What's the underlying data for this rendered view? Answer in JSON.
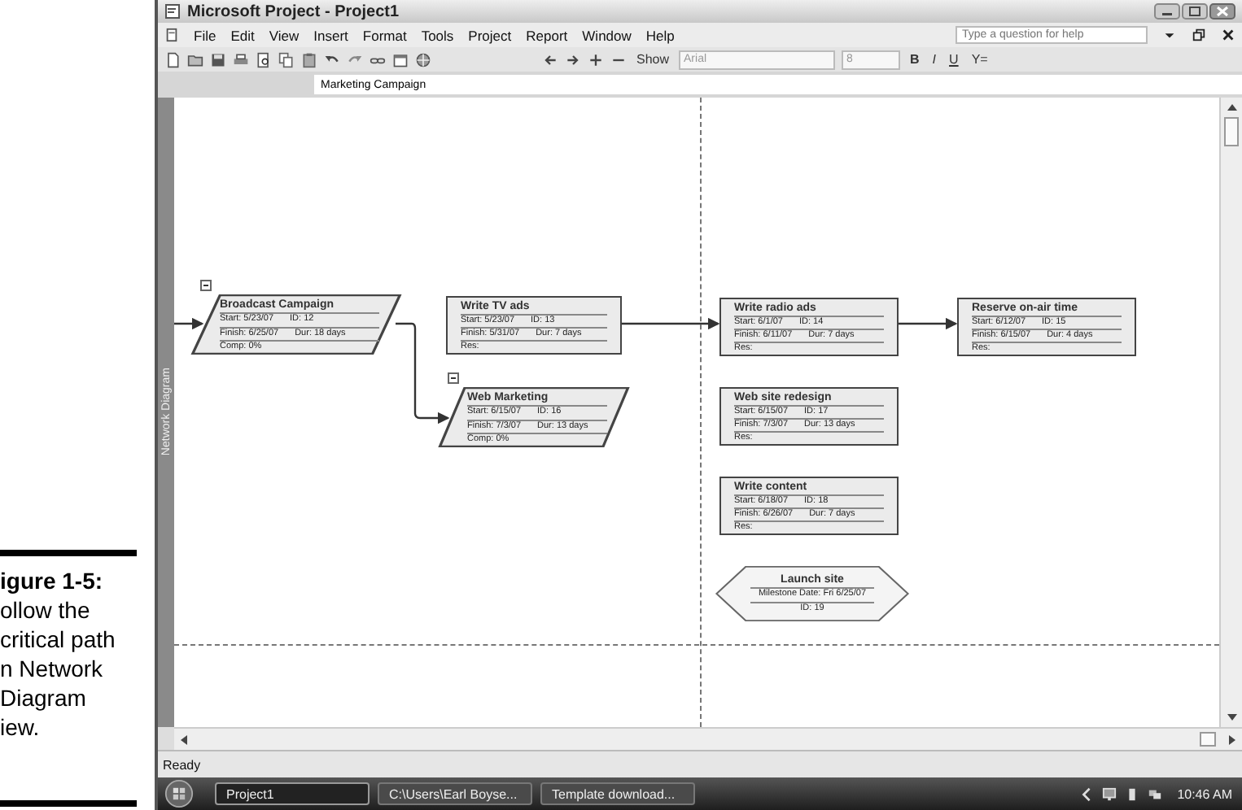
{
  "caption": {
    "title": "igure 1-5:",
    "lines": [
      "ollow the",
      "critical path",
      "n Network",
      "Diagram",
      "iew."
    ]
  },
  "window": {
    "title": "Microsoft Project - Project1"
  },
  "menu": [
    "File",
    "Edit",
    "View",
    "Insert",
    "Format",
    "Tools",
    "Project",
    "Report",
    "Window",
    "Help"
  ],
  "help_search": {
    "placeholder": "Type a question for help"
  },
  "toolbar": {
    "show": "Show",
    "font": "Arial",
    "size": "8",
    "bold": "B",
    "italic": "I",
    "underline": "U",
    "filter": "Y="
  },
  "entry_bar": {
    "value": "Marketing Campaign"
  },
  "view_label": "Network Diagram",
  "nodes": [
    {
      "kind": "summary",
      "name": "Broadcast Campaign",
      "rows": [
        [
          "Start: 5/23/07",
          "ID: 12"
        ],
        [
          "Finish: 6/25/07",
          "Dur: 18 days"
        ],
        [
          "Comp: 0%"
        ]
      ]
    },
    {
      "kind": "task",
      "name": "Write TV ads",
      "rows": [
        [
          "Start: 5/23/07",
          "ID: 13"
        ],
        [
          "Finish: 5/31/07",
          "Dur: 7 days"
        ],
        [
          "Res:"
        ]
      ]
    },
    {
      "kind": "summary",
      "name": "Web Marketing",
      "rows": [
        [
          "Start: 6/15/07",
          "ID: 16"
        ],
        [
          "Finish: 7/3/07",
          "Dur: 13 days"
        ],
        [
          "Comp: 0%"
        ]
      ]
    },
    {
      "kind": "task",
      "name": "Write radio ads",
      "rows": [
        [
          "Start: 6/1/07",
          "ID: 14"
        ],
        [
          "Finish: 6/11/07",
          "Dur: 7 days"
        ],
        [
          "Res:"
        ]
      ]
    },
    {
      "kind": "task",
      "name": "Reserve on-air time",
      "rows": [
        [
          "Start: 6/12/07",
          "ID: 15"
        ],
        [
          "Finish: 6/15/07",
          "Dur: 4 days"
        ],
        [
          "Res:"
        ]
      ]
    },
    {
      "kind": "task",
      "name": "Web site redesign",
      "rows": [
        [
          "Start: 6/15/07",
          "ID: 17"
        ],
        [
          "Finish: 7/3/07",
          "Dur: 13 days"
        ],
        [
          "Res:"
        ]
      ]
    },
    {
      "kind": "task",
      "name": "Write content",
      "rows": [
        [
          "Start: 6/18/07",
          "ID: 18"
        ],
        [
          "Finish: 6/26/07",
          "Dur: 7 days"
        ],
        [
          "Res:"
        ]
      ]
    },
    {
      "kind": "milestone",
      "name": "Launch site",
      "rows": [
        [
          "Milestone Date: Fri 6/25/07"
        ],
        [
          "ID: 19"
        ]
      ]
    }
  ],
  "status_bar": {
    "text": "Ready"
  },
  "taskbar": {
    "buttons": [
      {
        "label": "Project1",
        "selected": true
      },
      {
        "label": "C:\\Users\\Earl Boyse...",
        "selected": false
      },
      {
        "label": "Template download...",
        "selected": false
      }
    ],
    "clock": "10:46 AM"
  }
}
